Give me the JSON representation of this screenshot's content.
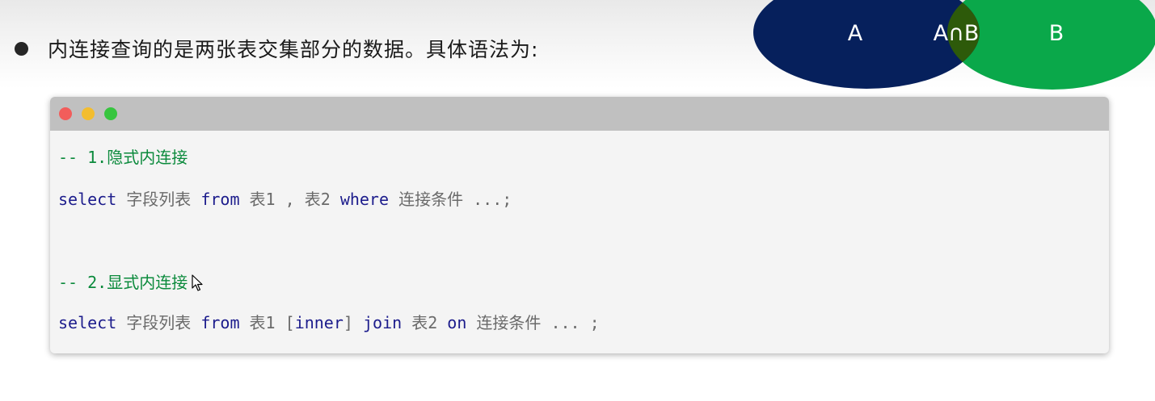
{
  "bullet": {
    "text": "内连接查询的是两张表交集部分的数据。具体语法为:"
  },
  "venn": {
    "left_label": "A",
    "intersection_label": "A∩B",
    "right_label": "B",
    "colors": {
      "left": "#06205c",
      "intersection": "#2d5a0a",
      "right": "#0aa84a"
    }
  },
  "code": {
    "window_controls": [
      "close",
      "minimize",
      "maximize"
    ],
    "comment1": "-- 1.隐式内连接",
    "line1": {
      "select": "select",
      "fields": " 字段列表 ",
      "from": "from",
      "tables": " 表1 , 表2 ",
      "where": "where",
      "rest": " 连接条件 ...;"
    },
    "comment2": "-- 2.显式内连接",
    "line2": {
      "select": "select",
      "fields": " 字段列表 ",
      "from": "from",
      "table1": " 表1 [",
      "inner": "inner",
      "bracket": "] ",
      "join": "join",
      "table2": " 表2 ",
      "on": "on",
      "rest": " 连接条件 ... ;"
    }
  }
}
